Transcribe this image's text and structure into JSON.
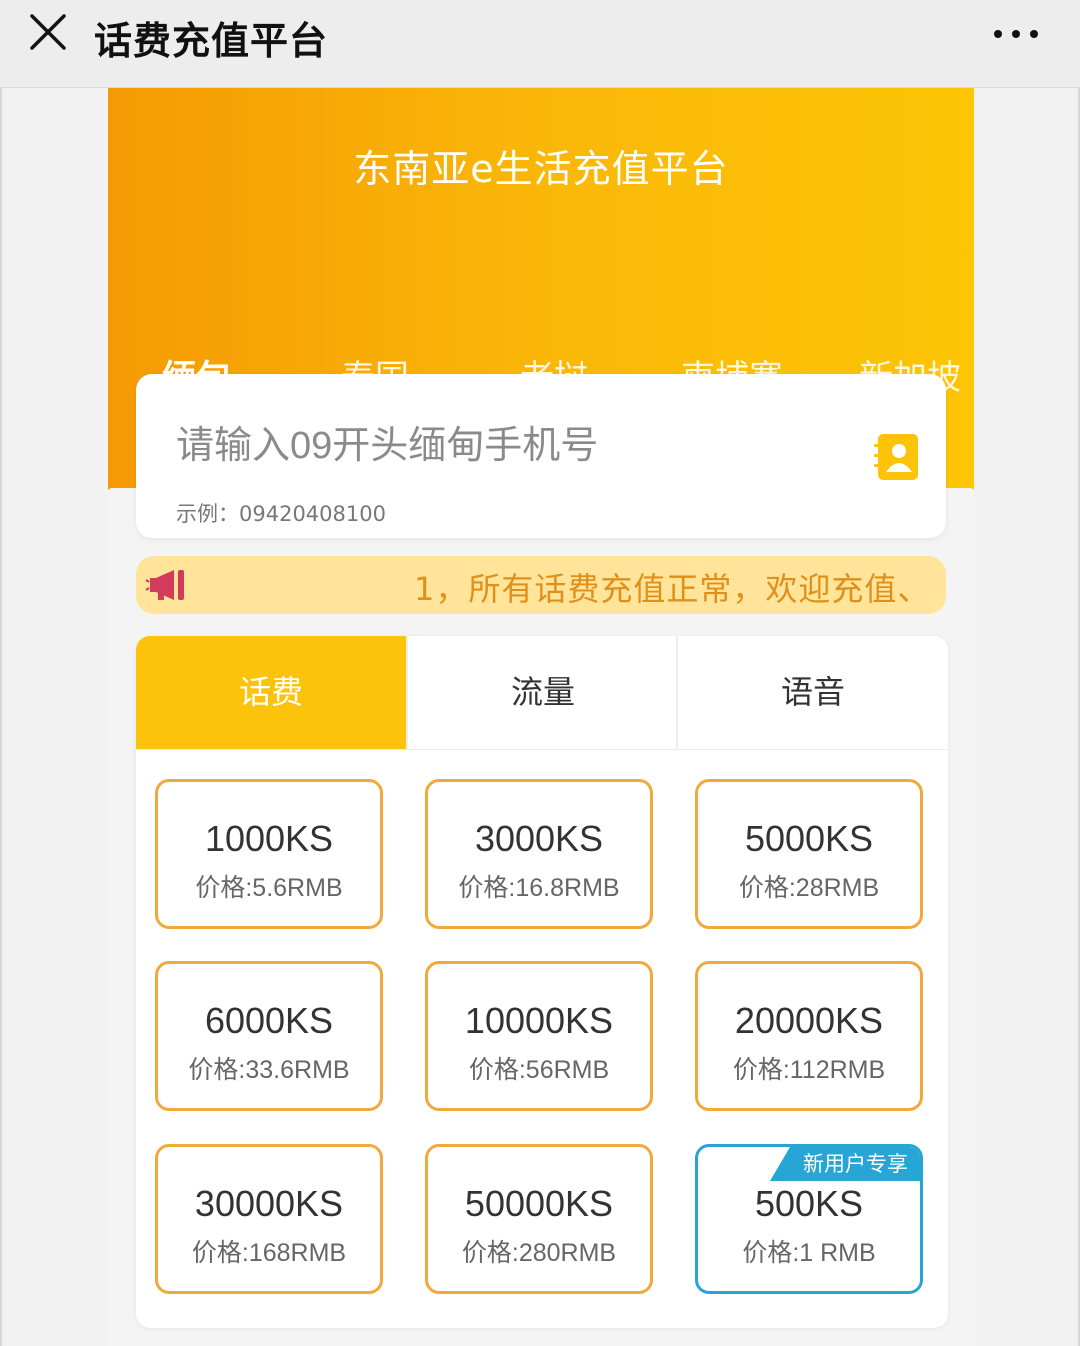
{
  "navbar": {
    "title": "话费充值平台"
  },
  "hero": {
    "title": "东南亚e生活充值平台",
    "countries": [
      "缅甸",
      "泰国",
      "老挝",
      "柬埔寨",
      "新加坡"
    ],
    "active_country": "缅甸"
  },
  "phone": {
    "placeholder": "请输入09开头缅甸手机号",
    "example": "示例：09420408100"
  },
  "notice": {
    "text": "1，所有话费充值正常，欢迎充值、"
  },
  "types": {
    "tabs": [
      "话费",
      "流量",
      "语音"
    ],
    "active": "话费"
  },
  "products": [
    {
      "amount": "1000KS",
      "price": "价格:5.6RMB"
    },
    {
      "amount": "3000KS",
      "price": "价格:16.8RMB"
    },
    {
      "amount": "5000KS",
      "price": "价格:28RMB"
    },
    {
      "amount": "6000KS",
      "price": "价格:33.6RMB"
    },
    {
      "amount": "10000KS",
      "price": "价格:56RMB"
    },
    {
      "amount": "20000KS",
      "price": "价格:112RMB"
    },
    {
      "amount": "30000KS",
      "price": "价格:168RMB"
    },
    {
      "amount": "50000KS",
      "price": "价格:280RMB"
    },
    {
      "amount": "500KS",
      "price": "价格:1 RMB",
      "badge": "新用户专享"
    }
  ],
  "colors": {
    "accent": "#fdc30a",
    "hero_start": "#f59a05",
    "hero_end": "#fdc505",
    "card_border": "#f2a93b",
    "special_border": "#27a6d6",
    "notice_bg": "#ffe49a",
    "notice_text": "#e0901a"
  },
  "icons": {
    "close": "close-icon",
    "more": "more-icon",
    "contact": "contact-book-icon",
    "notice": "megaphone-icon"
  }
}
